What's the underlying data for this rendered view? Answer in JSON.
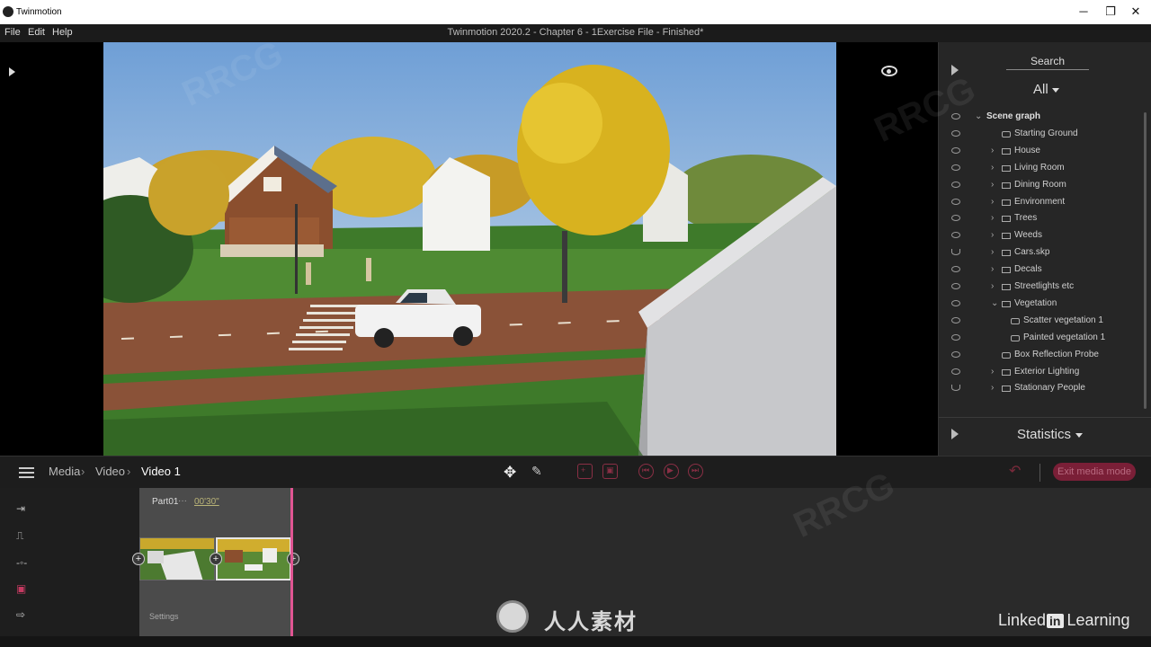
{
  "window": {
    "app_name": "Twinmotion",
    "doc_title": "Twinmotion 2020.2 - Chapter 6 - 1Exercise File - Finished*",
    "controls": {
      "minimize": "─",
      "maximize": "❐",
      "close": "✕"
    }
  },
  "menu": {
    "file": "File",
    "edit": "Edit",
    "help": "Help"
  },
  "right_panel": {
    "search_label": "Search",
    "filter": "All",
    "scene_graph": [
      {
        "label": "Scene graph",
        "visible": true,
        "expanded": true,
        "level": 0,
        "icon": "none",
        "bold": true
      },
      {
        "label": "Starting Ground",
        "visible": true,
        "level": 1,
        "icon": "object-icon"
      },
      {
        "label": "House",
        "visible": true,
        "level": 1,
        "icon": "folder-icon",
        "collapsed": true
      },
      {
        "label": "Living Room",
        "visible": true,
        "level": 1,
        "icon": "folder-icon",
        "collapsed": true
      },
      {
        "label": "Dining Room",
        "visible": true,
        "level": 1,
        "icon": "folder-icon",
        "collapsed": true
      },
      {
        "label": "Environment",
        "visible": true,
        "level": 1,
        "icon": "folder-icon",
        "collapsed": true
      },
      {
        "label": "Trees",
        "visible": true,
        "level": 1,
        "icon": "folder-icon",
        "collapsed": true
      },
      {
        "label": "Weeds",
        "visible": true,
        "level": 1,
        "icon": "folder-icon",
        "collapsed": true
      },
      {
        "label": "Cars.skp",
        "visible": false,
        "level": 1,
        "icon": "folder-icon",
        "collapsed": true
      },
      {
        "label": "Decals",
        "visible": true,
        "level": 1,
        "icon": "folder-icon",
        "collapsed": true
      },
      {
        "label": "Streetlights etc",
        "visible": true,
        "level": 1,
        "icon": "folder-icon",
        "collapsed": true
      },
      {
        "label": "Vegetation",
        "visible": true,
        "level": 1,
        "icon": "folder-icon",
        "expanded": true
      },
      {
        "label": "Scatter vegetation 1",
        "visible": true,
        "level": 2,
        "icon": "vegetation-icon"
      },
      {
        "label": "Painted vegetation 1",
        "visible": true,
        "level": 2,
        "icon": "vegetation-icon"
      },
      {
        "label": "Box Reflection Probe",
        "visible": true,
        "level": 1,
        "icon": "probe-icon"
      },
      {
        "label": "Exterior Lighting",
        "visible": true,
        "level": 1,
        "icon": "folder-icon",
        "collapsed": true
      },
      {
        "label": "Stationary People",
        "visible": false,
        "level": 1,
        "icon": "folder-icon",
        "collapsed": true
      }
    ],
    "statistics_label": "Statistics"
  },
  "media_bar": {
    "breadcrumb": [
      "Media",
      "Video",
      "Video 1"
    ],
    "exit_button": "Exit media mode"
  },
  "timeline": {
    "part_name": "Part01",
    "part_dots": "···",
    "part_time": "00'30\"",
    "settings_label": "Settings"
  },
  "branding": {
    "linkedin_pre": "Linked",
    "linkedin_in": "in",
    "linkedin_post": "Learning",
    "watermark_text": "人人素材",
    "watermark_rrcg": "RRCG"
  },
  "colors": {
    "accent": "#e05592",
    "exit_button_bg": "#7a1f37",
    "panel_bg": "#262626"
  }
}
